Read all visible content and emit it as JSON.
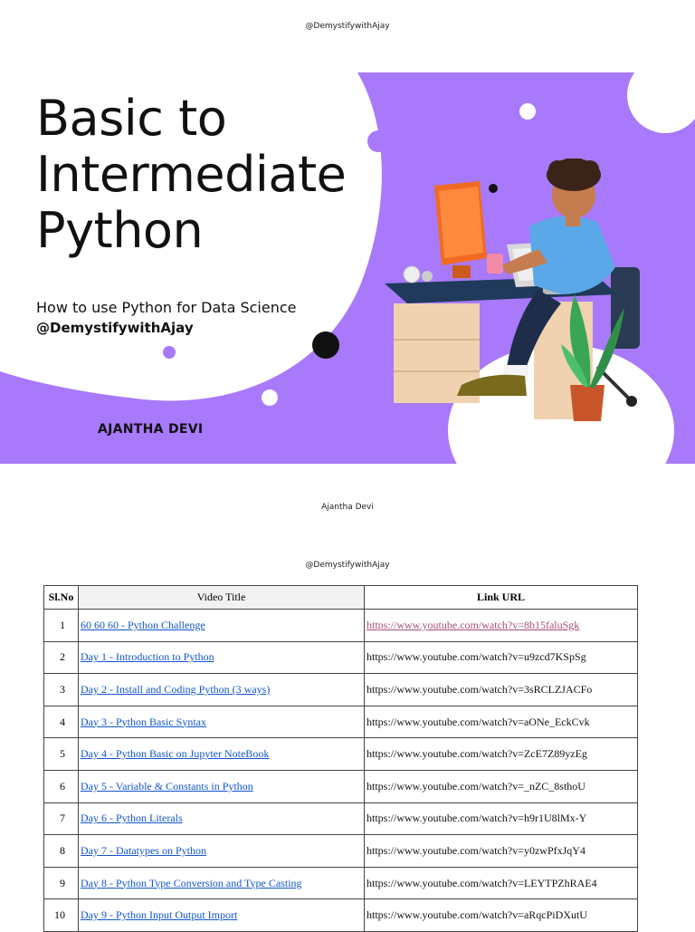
{
  "header": {
    "handle": "@DemystifywithAjay"
  },
  "cover": {
    "title_lines": [
      "Basic to",
      "Intermediate",
      "Python"
    ],
    "subtitle": "How to use Python for Data Science",
    "handle": "@DemystifywithAjay",
    "author": "AJANTHA DEVI",
    "colors": {
      "accent": "#a879fb",
      "text": "#111111"
    }
  },
  "footer": {
    "author": "Ajantha Devi"
  },
  "page2": {
    "header": "@DemystifywithAjay"
  },
  "table": {
    "headers": [
      "Sl.No",
      "Video Title",
      "Link URL"
    ],
    "rows": [
      {
        "no": "1",
        "title": "60 60 60 - Python Challenge",
        "url": "https://www.youtube.com/watch?v=8b15faluSgk"
      },
      {
        "no": "2",
        "title": "Day 1 - Introduction to Python",
        "url": "https://www.youtube.com/watch?v=u9zcd7KSpSg"
      },
      {
        "no": "3",
        "title": "Day 2 - Install and Coding Python (3 ways)",
        "url": "https://www.youtube.com/watch?v=3sRCLZJACFo"
      },
      {
        "no": "4",
        "title": "Day 3 - Python Basic Syntax",
        "url": "https://www.youtube.com/watch?v=aONe_EckCvk"
      },
      {
        "no": "5",
        "title": "Day 4 - Python Basic on Jupyter NoteBook",
        "url": "https://www.youtube.com/watch?v=ZcE7Z89yzEg"
      },
      {
        "no": "6",
        "title": "Day 5 - Variable & Constants in Python",
        "url": "https://www.youtube.com/watch?v=_nZC_8sthoU"
      },
      {
        "no": "7",
        "title": "Day 6 - Python Literals",
        "url": "https://www.youtube.com/watch?v=h9r1U8lMx-Y"
      },
      {
        "no": "8",
        "title": "Day 7 - Datatypes on Python",
        "url": "https://www.youtube.com/watch?v=y0zwPfxJqY4"
      },
      {
        "no": "9",
        "title": "Day 8 - Python Type Conversion and Type Casting",
        "url": "https://www.youtube.com/watch?v=LEYTPZhRAE4"
      },
      {
        "no": "10",
        "title": "Day 9 - Python Input Output Import",
        "url": "https://www.youtube.com/watch?v=aRqcPiDXutU"
      }
    ]
  }
}
